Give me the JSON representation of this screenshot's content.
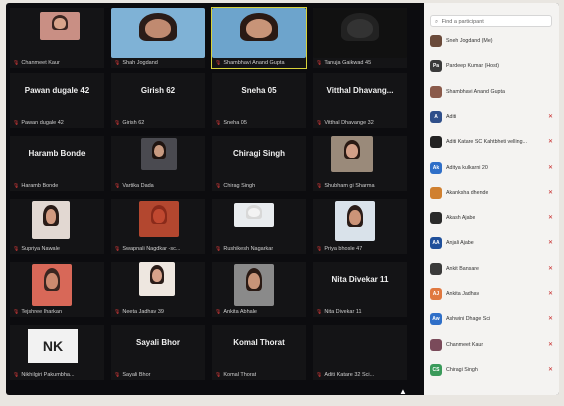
{
  "gallery": {
    "tiles": [
      {
        "label": "Chanmeet Kaur",
        "big": "",
        "video": "v1"
      },
      {
        "label": "Shah Jogdand",
        "big": "",
        "video": "v2"
      },
      {
        "label": "Shambhavi Anand Gupta",
        "big": "",
        "video": "v3"
      },
      {
        "label": "Tanuja Gaikwad 45",
        "big": "",
        "video": "v4"
      },
      {
        "label": "Pawan dugale 42",
        "big": "Pawan dugale 42",
        "video": ""
      },
      {
        "label": "Girish 62",
        "big": "Girish 62",
        "video": ""
      },
      {
        "label": "Sneha 05",
        "big": "Sneha 05",
        "video": ""
      },
      {
        "label": "Vitthal Dhavange 32",
        "big": "Vitthal Dhavang...",
        "video": ""
      },
      {
        "label": "Haramb Bonde",
        "big": "Haramb Bonde",
        "video": ""
      },
      {
        "label": "Vartika Dada",
        "big": "",
        "video": "v5"
      },
      {
        "label": "Chirag Singh",
        "big": "Chiragi Singh",
        "video": ""
      },
      {
        "label": "Shubham gi Sharma",
        "big": "",
        "video": "v6"
      },
      {
        "label": "Supriya Nawale",
        "big": "",
        "video": "v7"
      },
      {
        "label": "Swapnali Nagdkar -sc...",
        "big": "",
        "video": "v8"
      },
      {
        "label": "Rushikesh Nagarkar",
        "big": "",
        "video": "v9"
      },
      {
        "label": "Priya bhosle 47",
        "big": "",
        "video": "v10"
      },
      {
        "label": "Tejshree Iharkan",
        "big": "",
        "video": "v11"
      },
      {
        "label": "Neeta Jadhav 39",
        "big": "",
        "video": "v12"
      },
      {
        "label": "Ankita Abhale",
        "big": "",
        "video": "v13"
      },
      {
        "label": "Nita Divekar 11",
        "big": "Nita Divekar 11",
        "video": ""
      },
      {
        "label": "Nikhilgiri Pakumbha...",
        "big": "",
        "video": "nk",
        "initials": "NK"
      },
      {
        "label": "Sayali Bhor",
        "big": "Sayali Bhor",
        "video": ""
      },
      {
        "label": "Komal Thorat",
        "big": "Komal Thorat",
        "video": ""
      },
      {
        "label": "Aditi Katare 32 Sci...",
        "big": "",
        "video": ""
      }
    ]
  },
  "participants": {
    "search_placeholder": "Find a participant",
    "list": [
      {
        "name": "Sneh Jogdand (Me)",
        "initials": "",
        "color": "#6a4a3a"
      },
      {
        "name": "Pardeep Kumar (Host)",
        "initials": "Pa",
        "color": "#3a3a3a"
      },
      {
        "name": "Shambhavi Anand Gupta",
        "initials": "",
        "color": "#8a5a4a"
      },
      {
        "name": "Aditi",
        "initials": "A",
        "color": "#2f4f8a"
      },
      {
        "name": "Aditi Katare SC Kahtbheti velling...",
        "initials": "",
        "color": "#222222"
      },
      {
        "name": "Aditya kulkarni 20",
        "initials": "Ak",
        "color": "#2f6fc8"
      },
      {
        "name": "Akanksha dhende",
        "initials": "",
        "color": "#d08030"
      },
      {
        "name": "Akash Ajabe",
        "initials": "",
        "color": "#2a2a2a"
      },
      {
        "name": "Anjali Ajabe",
        "initials": "AA",
        "color": "#1f4f9a"
      },
      {
        "name": "Ankit Bansare",
        "initials": "",
        "color": "#3a3a3a"
      },
      {
        "name": "Ankita Jadhav",
        "initials": "AJ",
        "color": "#e07840"
      },
      {
        "name": "Ashwini Dhage Sci",
        "initials": "Aw",
        "color": "#2f6fc8"
      },
      {
        "name": "Chanmeet Kaur",
        "initials": "",
        "color": "#7a4a5a"
      },
      {
        "name": "Chiragi Singh",
        "initials": "CS",
        "color": "#3a9a5a"
      }
    ]
  }
}
